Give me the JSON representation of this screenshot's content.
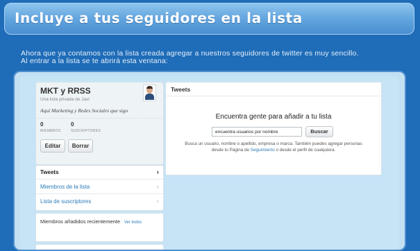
{
  "banner": {
    "title": "Incluye a tus seguidores en la lista"
  },
  "intro": {
    "line1": "Ahora que ya contamos con la lista creada agregar a nuestros seguidores de twitter es muy sencillo.",
    "line2": "Al entrar a la lista se te abrirá esta ventana:"
  },
  "profile": {
    "name": "MKT y RRSS",
    "subtitle": "Una lista privada de Javi",
    "description": "Aqui Marketing y Redes Sociales que sigo",
    "members_count": "0",
    "members_label": "MIEMBROS",
    "subscribers_count": "0",
    "subscribers_label": "SUSCRIPTORES",
    "edit_label": "Editar",
    "delete_label": "Borrar"
  },
  "menu": {
    "items": [
      {
        "label": "Tweets",
        "chevron": "›"
      },
      {
        "label": "Miembros de la lista",
        "chevron": "›"
      },
      {
        "label": "Lista de suscriptores",
        "chevron": "›"
      }
    ]
  },
  "recent": {
    "text": "Miembros añadidos recientemente",
    "link": "Ver todos"
  },
  "panel": {
    "header": "Tweets",
    "find_title": "Encuentra gente para añadir a tu lista",
    "search_value": "encuentra usuarios por nombre",
    "search_button": "Buscar",
    "help_before": "Busca un usuario, nombre o apellido, empresa o marca. También puedes agregar personas desde tu Página de ",
    "help_link": "Seguimiento",
    "help_after": " o desde el perfil de cualquiera."
  },
  "colors": {
    "background": "#1f6cb8",
    "banner": "#5fa2dd",
    "link": "#2b7bb9"
  }
}
